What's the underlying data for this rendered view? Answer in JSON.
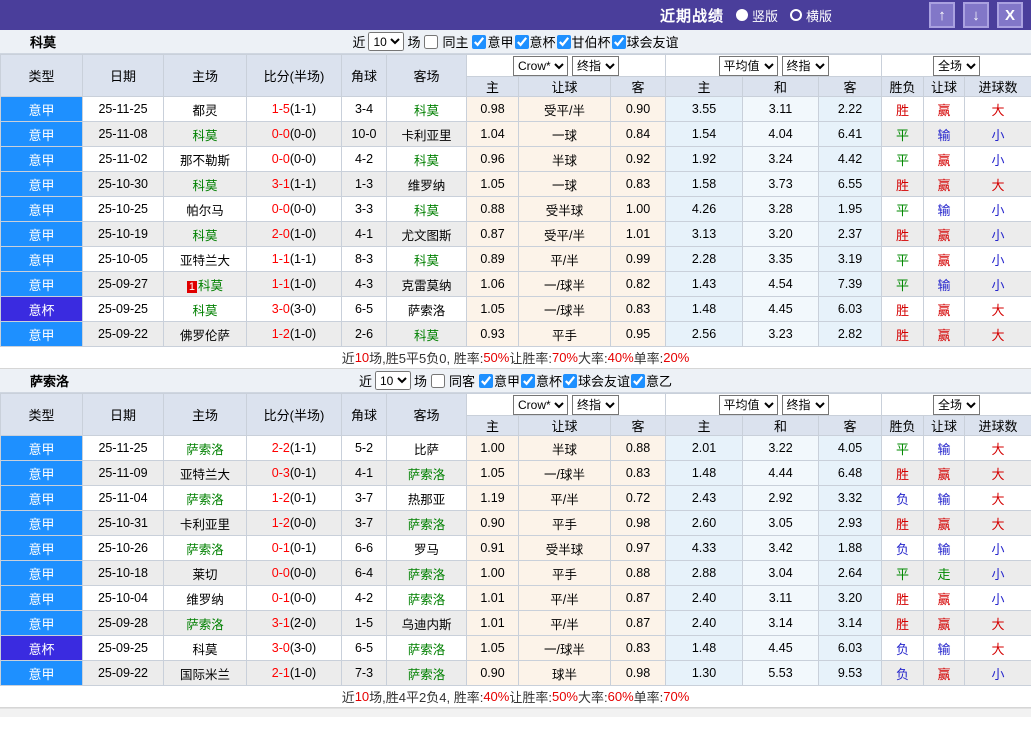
{
  "titlebar": {
    "title": "近期战绩",
    "vertical_label": "竖版",
    "horizontal_label": "横版",
    "up_button": "↑",
    "down_button": "↓",
    "close_button": "X"
  },
  "table_header": {
    "type": "类型",
    "date": "日期",
    "home": "主场",
    "score": "比分(半场)",
    "corner": "角球",
    "away": "客场",
    "crow": "Crow*",
    "final": "终指",
    "avg": "平均值",
    "full": "全场",
    "home_odds": "主",
    "handicap": "让球",
    "away_odds": "客",
    "draw_odds": "和",
    "wdl": "胜负",
    "goals": "进球数"
  },
  "type_colors": {
    "意甲": "#1e90ff",
    "意杯": "#3a2be0"
  },
  "result_colors": {
    "胜": "#d40000",
    "平": "#008800",
    "负": "#2525cc",
    "赢": "#d40000",
    "输": "#2525cc",
    "走": "#008800",
    "大": "#d40000",
    "小": "#2525cc"
  },
  "sections": [
    {
      "team": "科莫",
      "filter": {
        "near": "近",
        "count": "10",
        "games": "场",
        "same": "同主",
        "same_checked": false,
        "leagues": [
          {
            "label": "意甲",
            "checked": true
          },
          {
            "label": "意杯",
            "checked": true
          },
          {
            "label": "甘伯杯",
            "checked": true
          },
          {
            "label": "球会友谊",
            "checked": true
          }
        ]
      },
      "rows": [
        {
          "type": "意甲",
          "date": "25-11-25",
          "home": "都灵",
          "home_hl": false,
          "badge": "",
          "score": "1-5",
          "half": "(1-1)",
          "corner": "3-4",
          "away": "科莫",
          "away_hl": true,
          "crow": [
            "0.98",
            "受平/半",
            "0.90"
          ],
          "avg": [
            "3.55",
            "3.11",
            "2.22"
          ],
          "res": [
            "胜",
            "赢",
            "大"
          ]
        },
        {
          "type": "意甲",
          "date": "25-11-08",
          "home": "科莫",
          "home_hl": true,
          "badge": "",
          "score": "0-0",
          "half": "(0-0)",
          "corner": "10-0",
          "away": "卡利亚里",
          "away_hl": false,
          "crow": [
            "1.04",
            "一球",
            "0.84"
          ],
          "avg": [
            "1.54",
            "4.04",
            "6.41"
          ],
          "res": [
            "平",
            "输",
            "小"
          ]
        },
        {
          "type": "意甲",
          "date": "25-11-02",
          "home": "那不勒斯",
          "home_hl": false,
          "badge": "",
          "score": "0-0",
          "half": "(0-0)",
          "corner": "4-2",
          "away": "科莫",
          "away_hl": true,
          "crow": [
            "0.96",
            "半球",
            "0.92"
          ],
          "avg": [
            "1.92",
            "3.24",
            "4.42"
          ],
          "res": [
            "平",
            "赢",
            "小"
          ]
        },
        {
          "type": "意甲",
          "date": "25-10-30",
          "home": "科莫",
          "home_hl": true,
          "badge": "",
          "score": "3-1",
          "half": "(1-1)",
          "corner": "1-3",
          "away": "维罗纳",
          "away_hl": false,
          "crow": [
            "1.05",
            "一球",
            "0.83"
          ],
          "avg": [
            "1.58",
            "3.73",
            "6.55"
          ],
          "res": [
            "胜",
            "赢",
            "大"
          ]
        },
        {
          "type": "意甲",
          "date": "25-10-25",
          "home": "帕尔马",
          "home_hl": false,
          "badge": "",
          "score": "0-0",
          "half": "(0-0)",
          "corner": "3-3",
          "away": "科莫",
          "away_hl": true,
          "crow": [
            "0.88",
            "受半球",
            "1.00"
          ],
          "avg": [
            "4.26",
            "3.28",
            "1.95"
          ],
          "res": [
            "平",
            "输",
            "小"
          ]
        },
        {
          "type": "意甲",
          "date": "25-10-19",
          "home": "科莫",
          "home_hl": true,
          "badge": "",
          "score": "2-0",
          "half": "(1-0)",
          "corner": "4-1",
          "away": "尤文图斯",
          "away_hl": false,
          "crow": [
            "0.87",
            "受平/半",
            "1.01"
          ],
          "avg": [
            "3.13",
            "3.20",
            "2.37"
          ],
          "res": [
            "胜",
            "赢",
            "小"
          ]
        },
        {
          "type": "意甲",
          "date": "25-10-05",
          "home": "亚特兰大",
          "home_hl": false,
          "badge": "",
          "score": "1-1",
          "half": "(1-1)",
          "corner": "8-3",
          "away": "科莫",
          "away_hl": true,
          "crow": [
            "0.89",
            "平/半",
            "0.99"
          ],
          "avg": [
            "2.28",
            "3.35",
            "3.19"
          ],
          "res": [
            "平",
            "赢",
            "小"
          ]
        },
        {
          "type": "意甲",
          "date": "25-09-27",
          "home": "科莫",
          "home_hl": true,
          "badge": "1",
          "score": "1-1",
          "half": "(1-0)",
          "corner": "4-3",
          "away": "克雷莫纳",
          "away_hl": false,
          "crow": [
            "1.06",
            "一/球半",
            "0.82"
          ],
          "avg": [
            "1.43",
            "4.54",
            "7.39"
          ],
          "res": [
            "平",
            "输",
            "小"
          ]
        },
        {
          "type": "意杯",
          "date": "25-09-25",
          "home": "科莫",
          "home_hl": true,
          "badge": "",
          "score": "3-0",
          "half": "(3-0)",
          "corner": "6-5",
          "away": "萨索洛",
          "away_hl": false,
          "crow": [
            "1.05",
            "一/球半",
            "0.83"
          ],
          "avg": [
            "1.48",
            "4.45",
            "6.03"
          ],
          "res": [
            "胜",
            "赢",
            "大"
          ]
        },
        {
          "type": "意甲",
          "date": "25-09-22",
          "home": "佛罗伦萨",
          "home_hl": false,
          "badge": "",
          "score": "1-2",
          "half": "(1-0)",
          "corner": "2-6",
          "away": "科莫",
          "away_hl": true,
          "crow": [
            "0.93",
            "平手",
            "0.95"
          ],
          "avg": [
            "2.56",
            "3.23",
            "2.82"
          ],
          "res": [
            "胜",
            "赢",
            "大"
          ]
        }
      ],
      "summary": [
        {
          "t": "近",
          "red": false
        },
        {
          "t": "10",
          "red": true
        },
        {
          "t": "场,胜5平5负0, 胜率:",
          "red": false
        },
        {
          "t": "50%",
          "red": true
        },
        {
          "t": " 让胜率:",
          "red": false
        },
        {
          "t": "70%",
          "red": true
        },
        {
          "t": " 大率:",
          "red": false
        },
        {
          "t": "40%",
          "red": true
        },
        {
          "t": " 单率:",
          "red": false
        },
        {
          "t": "20%",
          "red": true
        }
      ]
    },
    {
      "team": "萨索洛",
      "filter": {
        "near": "近",
        "count": "10",
        "games": "场",
        "same": "同客",
        "same_checked": false,
        "leagues": [
          {
            "label": "意甲",
            "checked": true
          },
          {
            "label": "意杯",
            "checked": true
          },
          {
            "label": "球会友谊",
            "checked": true
          },
          {
            "label": "意乙",
            "checked": true
          }
        ]
      },
      "rows": [
        {
          "type": "意甲",
          "date": "25-11-25",
          "home": "萨索洛",
          "home_hl": true,
          "badge": "",
          "score": "2-2",
          "half": "(1-1)",
          "corner": "5-2",
          "away": "比萨",
          "away_hl": false,
          "crow": [
            "1.00",
            "半球",
            "0.88"
          ],
          "avg": [
            "2.01",
            "3.22",
            "4.05"
          ],
          "res": [
            "平",
            "输",
            "大"
          ]
        },
        {
          "type": "意甲",
          "date": "25-11-09",
          "home": "亚特兰大",
          "home_hl": false,
          "badge": "",
          "score": "0-3",
          "half": "(0-1)",
          "corner": "4-1",
          "away": "萨索洛",
          "away_hl": true,
          "crow": [
            "1.05",
            "一/球半",
            "0.83"
          ],
          "avg": [
            "1.48",
            "4.44",
            "6.48"
          ],
          "res": [
            "胜",
            "赢",
            "大"
          ]
        },
        {
          "type": "意甲",
          "date": "25-11-04",
          "home": "萨索洛",
          "home_hl": true,
          "badge": "",
          "score": "1-2",
          "half": "(0-1)",
          "corner": "3-7",
          "away": "热那亚",
          "away_hl": false,
          "crow": [
            "1.19",
            "平/半",
            "0.72"
          ],
          "avg": [
            "2.43",
            "2.92",
            "3.32"
          ],
          "res": [
            "负",
            "输",
            "大"
          ]
        },
        {
          "type": "意甲",
          "date": "25-10-31",
          "home": "卡利亚里",
          "home_hl": false,
          "badge": "",
          "score": "1-2",
          "half": "(0-0)",
          "corner": "3-7",
          "away": "萨索洛",
          "away_hl": true,
          "crow": [
            "0.90",
            "平手",
            "0.98"
          ],
          "avg": [
            "2.60",
            "3.05",
            "2.93"
          ],
          "res": [
            "胜",
            "赢",
            "大"
          ]
        },
        {
          "type": "意甲",
          "date": "25-10-26",
          "home": "萨索洛",
          "home_hl": true,
          "badge": "",
          "score": "0-1",
          "half": "(0-1)",
          "corner": "6-6",
          "away": "罗马",
          "away_hl": false,
          "crow": [
            "0.91",
            "受半球",
            "0.97"
          ],
          "avg": [
            "4.33",
            "3.42",
            "1.88"
          ],
          "res": [
            "负",
            "输",
            "小"
          ]
        },
        {
          "type": "意甲",
          "date": "25-10-18",
          "home": "莱切",
          "home_hl": false,
          "badge": "",
          "score": "0-0",
          "half": "(0-0)",
          "corner": "6-4",
          "away": "萨索洛",
          "away_hl": true,
          "crow": [
            "1.00",
            "平手",
            "0.88"
          ],
          "avg": [
            "2.88",
            "3.04",
            "2.64"
          ],
          "res": [
            "平",
            "走",
            "小"
          ]
        },
        {
          "type": "意甲",
          "date": "25-10-04",
          "home": "维罗纳",
          "home_hl": false,
          "badge": "",
          "score": "0-1",
          "half": "(0-0)",
          "corner": "4-2",
          "away": "萨索洛",
          "away_hl": true,
          "crow": [
            "1.01",
            "平/半",
            "0.87"
          ],
          "avg": [
            "2.40",
            "3.11",
            "3.20"
          ],
          "res": [
            "胜",
            "赢",
            "小"
          ]
        },
        {
          "type": "意甲",
          "date": "25-09-28",
          "home": "萨索洛",
          "home_hl": true,
          "badge": "",
          "score": "3-1",
          "half": "(2-0)",
          "corner": "1-5",
          "away": "乌迪内斯",
          "away_hl": false,
          "crow": [
            "1.01",
            "平/半",
            "0.87"
          ],
          "avg": [
            "2.40",
            "3.14",
            "3.14"
          ],
          "res": [
            "胜",
            "赢",
            "大"
          ]
        },
        {
          "type": "意杯",
          "date": "25-09-25",
          "home": "科莫",
          "home_hl": false,
          "badge": "",
          "score": "3-0",
          "half": "(3-0)",
          "corner": "6-5",
          "away": "萨索洛",
          "away_hl": true,
          "crow": [
            "1.05",
            "一/球半",
            "0.83"
          ],
          "avg": [
            "1.48",
            "4.45",
            "6.03"
          ],
          "res": [
            "负",
            "输",
            "大"
          ]
        },
        {
          "type": "意甲",
          "date": "25-09-22",
          "home": "国际米兰",
          "home_hl": false,
          "badge": "",
          "score": "2-1",
          "half": "(1-0)",
          "corner": "7-3",
          "away": "萨索洛",
          "away_hl": true,
          "crow": [
            "0.90",
            "球半",
            "0.98"
          ],
          "avg": [
            "1.30",
            "5.53",
            "9.53"
          ],
          "res": [
            "负",
            "赢",
            "小"
          ]
        }
      ],
      "summary": [
        {
          "t": "近",
          "red": false
        },
        {
          "t": "10",
          "red": true
        },
        {
          "t": "场,胜4平2负4, 胜率:",
          "red": false
        },
        {
          "t": "40%",
          "red": true
        },
        {
          "t": " 让胜率:",
          "red": false
        },
        {
          "t": "50%",
          "red": true
        },
        {
          "t": " 大率:",
          "red": false
        },
        {
          "t": "60%",
          "red": true
        },
        {
          "t": " 单率:",
          "red": false
        },
        {
          "t": "70%",
          "red": true
        }
      ]
    }
  ]
}
